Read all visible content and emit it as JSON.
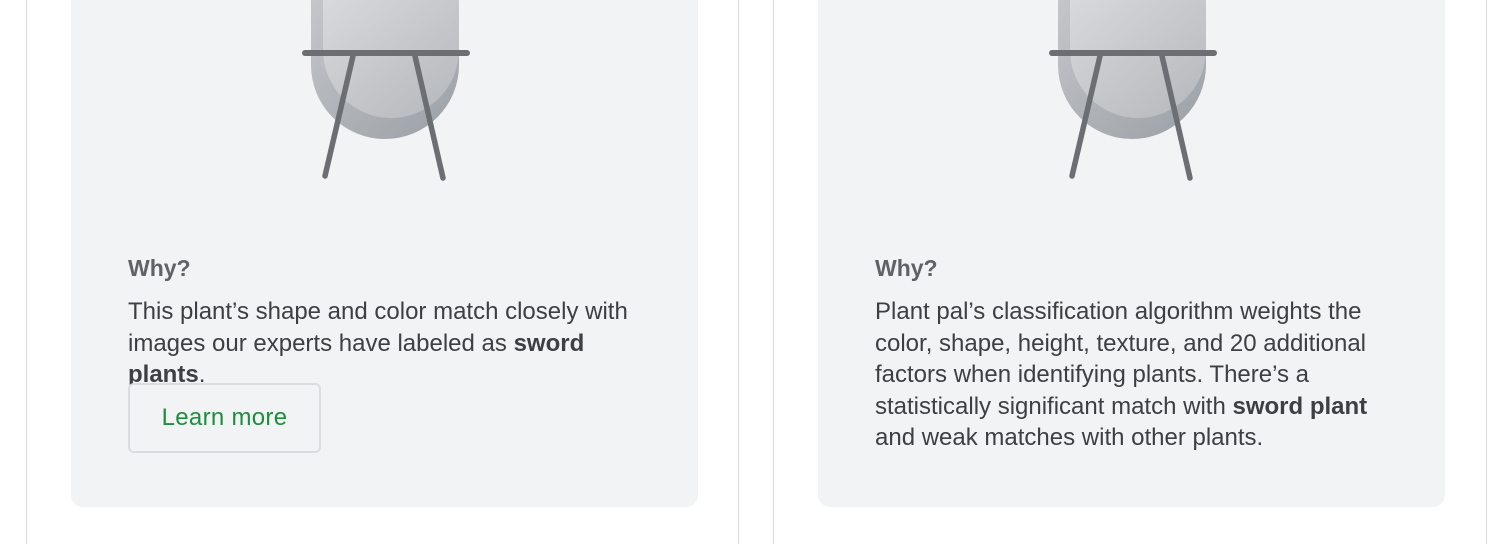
{
  "cards": [
    {
      "heading": "Why?",
      "text_before": "This plant’s shape and color match closely with images our experts have labeled as ",
      "bold": "sword plants",
      "text_after": ".",
      "button_label": "Learn more"
    },
    {
      "heading": "Why?",
      "text_before": "Plant pal’s classification algorithm weights the color, shape, height, texture, and 20 additional factors when identifying plants. There’s a statistically significant match with ",
      "bold": "sword plant",
      "text_after": " and weak matches with other plants."
    }
  ],
  "colors": {
    "card_background": "#f1f3f4",
    "heading": "#5f6368",
    "body_text": "#3c4043",
    "accent_green": "#1e8e3e",
    "border": "#dadce0"
  },
  "icons": [
    "plant-easel-illustration-icon"
  ]
}
